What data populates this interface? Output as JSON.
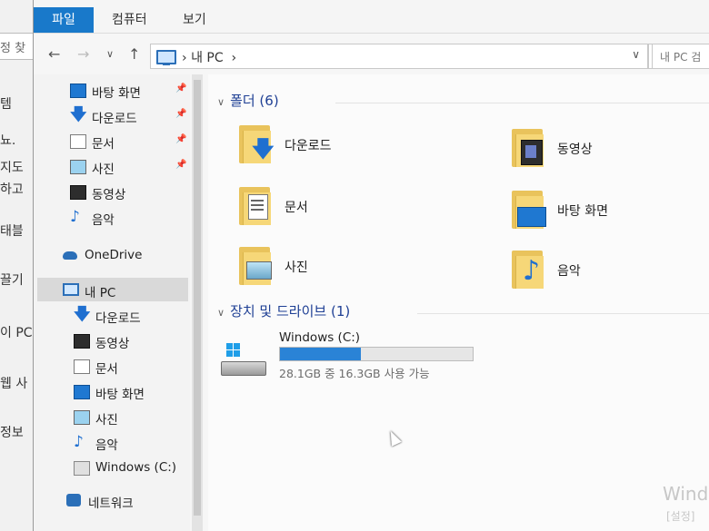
{
  "background_window": {
    "search_text": "정 찾",
    "lines": [
      "템",
      "뇨.",
      "지도",
      "하고",
      "태블",
      "끌기",
      "이 PC",
      "웹 사",
      "정보"
    ]
  },
  "ribbon": {
    "tabs": [
      "파일",
      "컴퓨터",
      "보기"
    ]
  },
  "address_bar": {
    "path_root": "내 PC",
    "search_placeholder": "내 PC 검"
  },
  "nav": {
    "quick_access": [
      {
        "label": "바탕 화면",
        "icon": "desktop-icon"
      },
      {
        "label": "다운로드",
        "icon": "download-icon"
      },
      {
        "label": "문서",
        "icon": "document-icon"
      },
      {
        "label": "사진",
        "icon": "picture-icon"
      },
      {
        "label": "동영상",
        "icon": "video-icon"
      },
      {
        "label": "음악",
        "icon": "music-icon"
      }
    ],
    "onedrive": "OneDrive",
    "this_pc": "내 PC",
    "pc_children": [
      {
        "label": "다운로드",
        "icon": "download-icon"
      },
      {
        "label": "동영상",
        "icon": "video-icon"
      },
      {
        "label": "문서",
        "icon": "document-icon"
      },
      {
        "label": "바탕 화면",
        "icon": "desktop-icon"
      },
      {
        "label": "사진",
        "icon": "picture-icon"
      },
      {
        "label": "음악",
        "icon": "music-icon"
      },
      {
        "label": "Windows (C:)",
        "icon": "drive-icon"
      }
    ],
    "network": "네트워크"
  },
  "content": {
    "folders_header": "폴더 (6)",
    "folders": [
      {
        "label": "다운로드",
        "icon": "download-folder-icon"
      },
      {
        "label": "동영상",
        "icon": "video-folder-icon"
      },
      {
        "label": "문서",
        "icon": "document-folder-icon"
      },
      {
        "label": "바탕 화면",
        "icon": "desktop-folder-icon"
      },
      {
        "label": "사진",
        "icon": "picture-folder-icon"
      },
      {
        "label": "음악",
        "icon": "music-folder-icon"
      }
    ],
    "drives_header": "장치 및 드라이브 (1)",
    "drive": {
      "name": "Windows (C:)",
      "info": "28.1GB 중 16.3GB 사용 가능",
      "used_fraction": 0.42
    }
  },
  "watermark": {
    "line1": "Wind",
    "line2": "[설정]"
  },
  "colors": {
    "accent": "#1979ca",
    "section_header": "#1e3f94",
    "usage_bar": "#2a83d6"
  }
}
